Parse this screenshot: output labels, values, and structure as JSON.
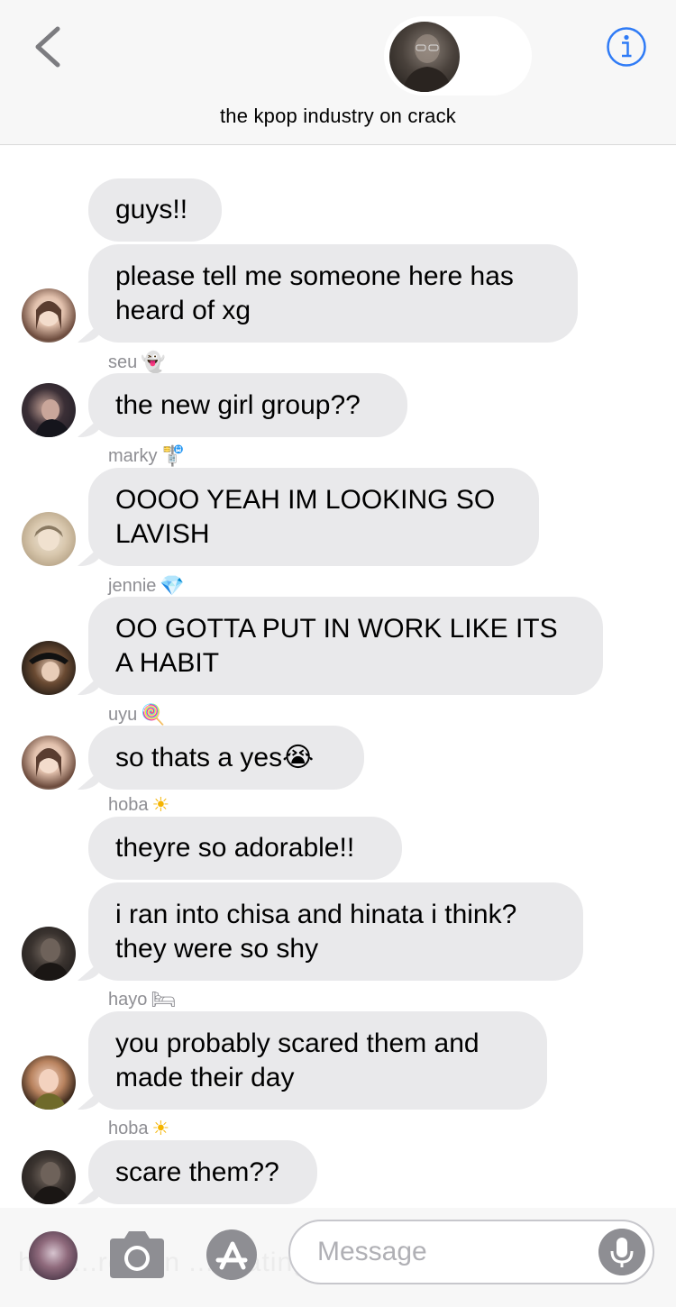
{
  "header": {
    "title": "the kpop industry on crack",
    "back_icon": "chevron-left-icon",
    "info_icon": "info-icon",
    "accent_color": "#2f7bf6"
  },
  "messages": [
    {
      "text": "guys!!"
    },
    {
      "text": "please tell me someone here has\nheard of xg"
    },
    {
      "sender": "seu",
      "sender_emoji": "👻",
      "text": "the new girl group??"
    },
    {
      "sender": "marky",
      "sender_emoji": "🚏",
      "text": "OOOO YEAH IM LOOKING SO\nLAVISH"
    },
    {
      "sender": "jennie",
      "sender_emoji": "💎",
      "text": "OO GOTTA PUT IN WORK LIKE ITS\nA HABIT"
    },
    {
      "sender": "uyu",
      "sender_emoji": "🍭",
      "text": "so thats a yes😭"
    },
    {
      "sender": "hoba",
      "sender_emoji": "☀",
      "text": "theyre so adorable!!"
    },
    {
      "text": "i ran into chisa and hinata i think?\nthey were so shy"
    },
    {
      "sender": "hayo",
      "sender_emoji": "🛏",
      "text": "you probably scared them and\nmade their day"
    },
    {
      "sender": "hoba",
      "sender_emoji": "☀",
      "text": "scare them??"
    }
  ],
  "composer": {
    "placeholder": "Message",
    "ghost_text": "hey ...re ...in ...ndating ...yung",
    "camera_icon": "camera-icon",
    "appstore_icon": "app-store-icon",
    "mic_icon": "microphone-icon"
  },
  "colors": {
    "bubble": "#e9e9eb",
    "sender_name": "#8e8e93",
    "header_bg": "#f7f7f7"
  }
}
